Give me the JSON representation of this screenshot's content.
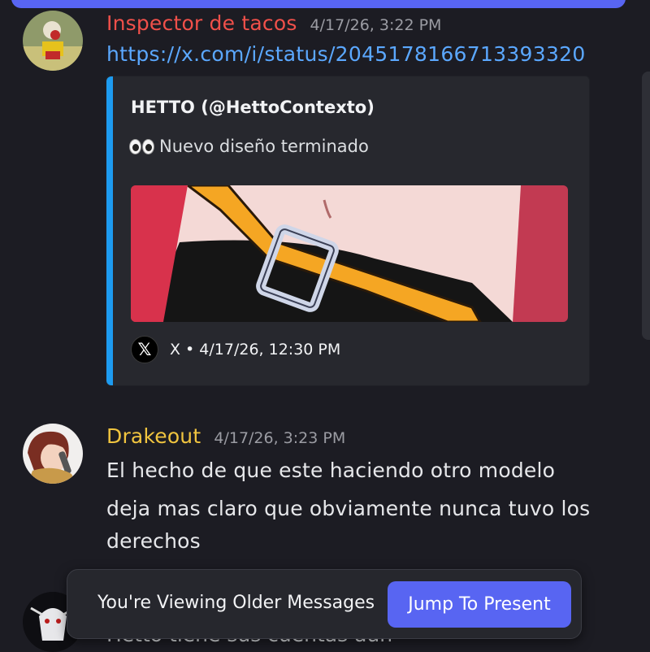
{
  "messages": [
    {
      "username": "Inspector de tacos",
      "username_color": "#f0504a",
      "timestamp": "4/17/26, 3:22 PM",
      "link": "https://x.com/i/status/2045178166713393320",
      "embed": {
        "author": "HETTO (@HettoContexto)",
        "description": "Nuevo diseño terminado",
        "accent_color": "#1d9bf0",
        "provider_icon": "x-logo-icon",
        "footer": "X • 4/17/26, 12:30 PM"
      }
    },
    {
      "username": "Drakeout",
      "username_color": "#f0c43f",
      "timestamp": "4/17/26, 3:23 PM",
      "lines": [
        "El hecho de que este haciendo otro modelo",
        "deja mas claro que obviamente nunca tuvo los",
        "derechos"
      ]
    },
    {
      "partial_text": "Hetto tiene sus cuentas aun"
    }
  ],
  "toast": {
    "text": "You're Viewing Older Messages",
    "button_label": "Jump To Present",
    "button_color": "#5865f2"
  }
}
